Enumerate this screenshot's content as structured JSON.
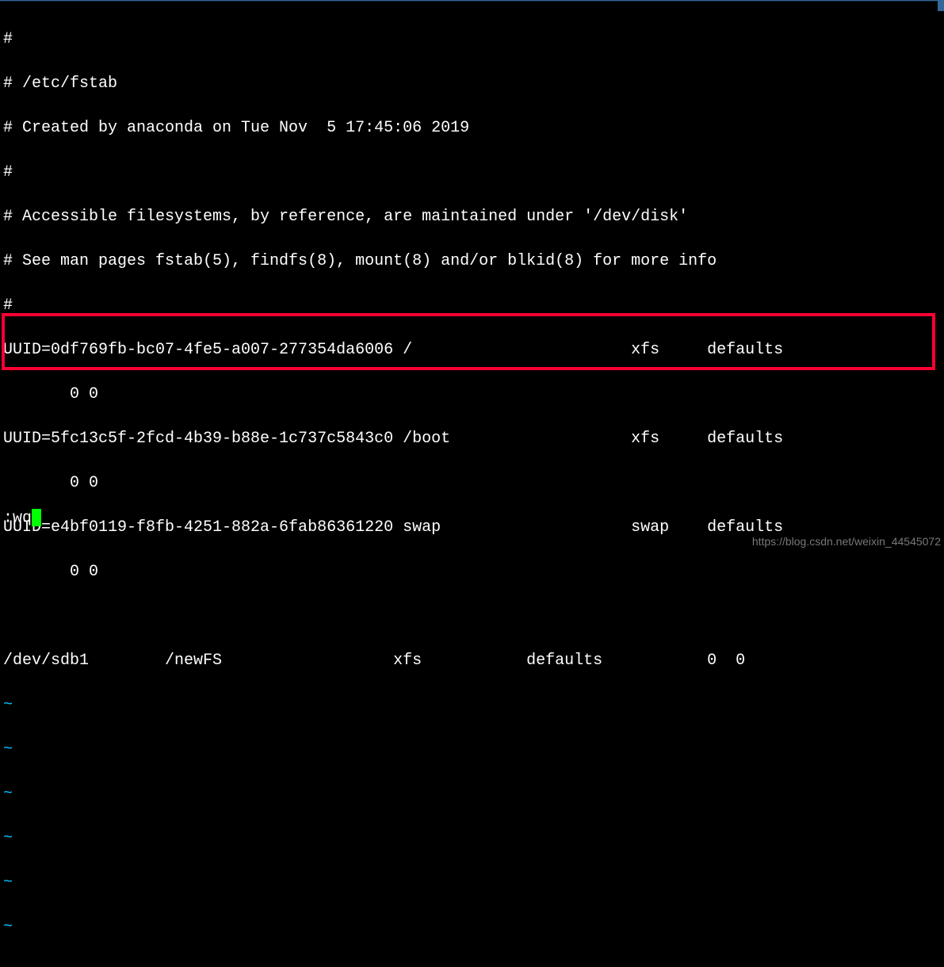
{
  "comments": {
    "l1": "#",
    "l2": "# /etc/fstab",
    "l3": "# Created by anaconda on Tue Nov  5 17:45:06 2019",
    "l4": "#",
    "l5": "# Accessible filesystems, by reference, are maintained under '/dev/disk'",
    "l6": "# See man pages fstab(5), findfs(8), mount(8) and/or blkid(8) for more info",
    "l7": "#"
  },
  "entries": {
    "e1a": "UUID=0df769fb-bc07-4fe5-a007-277354da6006 /                       xfs     defaults",
    "e1b": "       0 0",
    "e2a": "UUID=5fc13c5f-2fcd-4b39-b88e-1c737c5843c0 /boot                   xfs     defaults",
    "e2b": "       0 0",
    "e3a": "UUID=e4bf0119-f8fb-4251-882a-6fab86361220 swap                    swap    defaults",
    "e3b": "       0 0"
  },
  "new_entry": "/dev/sdb1        /newFS                  xfs           defaults           0  0",
  "tilde": "~",
  "command": ":wq",
  "watermark": "https://blog.csdn.net/weixin_44545072"
}
